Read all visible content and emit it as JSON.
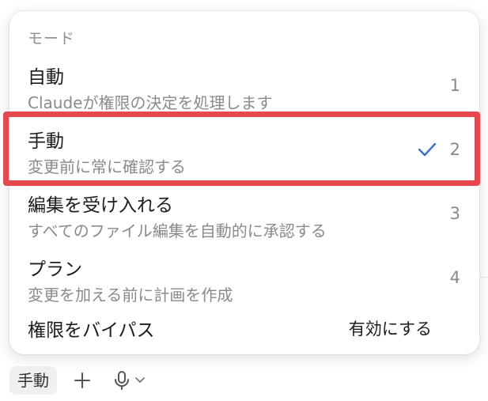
{
  "menu": {
    "header": "モード",
    "items": [
      {
        "title": "自動",
        "desc": "Claudeが権限の決定を処理します",
        "num": "1",
        "selected": false
      },
      {
        "title": "手動",
        "desc": "変更前に常に確認する",
        "num": "2",
        "selected": true
      },
      {
        "title": "編集を受け入れる",
        "desc": "すべてのファイル編集を自動的に承認する",
        "num": "3",
        "selected": false
      },
      {
        "title": "プラン",
        "desc": "変更を加える前に計画を作成",
        "num": "4",
        "selected": false
      }
    ],
    "bypass": {
      "title": "権限をバイパス",
      "action": "有効にする"
    }
  },
  "toolbar": {
    "mode_label": "手動",
    "add_icon": "plus-icon",
    "mic_icon": "microphone-icon",
    "chevron_icon": "chevron-down-icon"
  },
  "colors": {
    "accent_check": "#3b6fd4",
    "highlight": "#e5484d"
  }
}
